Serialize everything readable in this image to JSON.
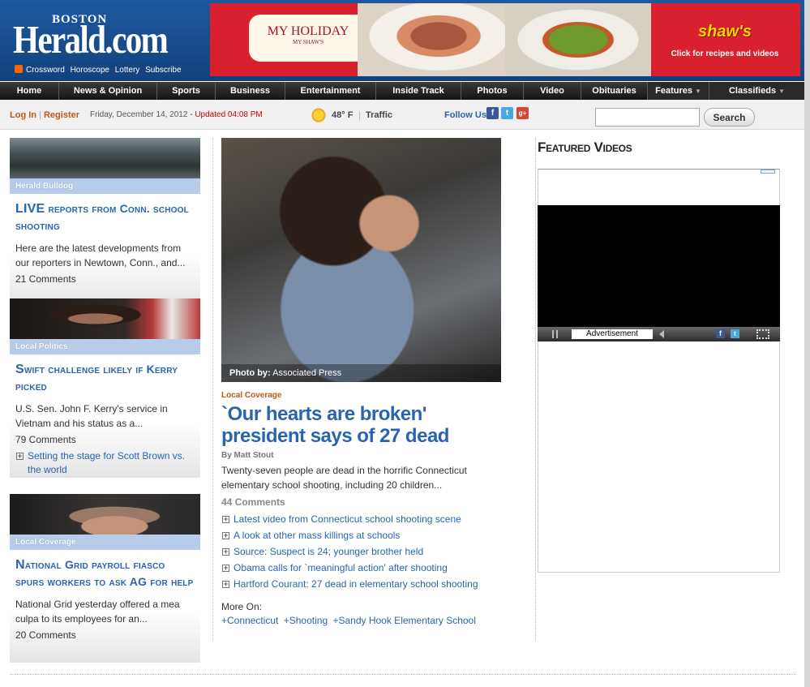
{
  "header": {
    "logo_top": "BOSTON",
    "logo_main": "Herald.com",
    "links": [
      "Crossword",
      "Horoscope",
      "Lottery",
      "Subscribe"
    ],
    "ad": {
      "badge_line1": "MY HOLIDAY",
      "badge_line2": "MY SHAW'S",
      "brand": "shaw's",
      "cta": "Click for recipes and videos",
      "color": "#d9202f"
    }
  },
  "nav": {
    "items": [
      {
        "label": "Home"
      },
      {
        "label": "News & Opinion"
      },
      {
        "label": "Sports"
      },
      {
        "label": "Business"
      },
      {
        "label": "Entertainment"
      },
      {
        "label": "Inside Track"
      },
      {
        "label": "Photos"
      },
      {
        "label": "Video"
      },
      {
        "label": "Obituaries"
      },
      {
        "label": "Features"
      },
      {
        "label": "Classifieds"
      }
    ]
  },
  "util": {
    "login": "Log In",
    "register": "Register",
    "date": "Friday, December 14, 2012",
    "updated": "- Updated 04:08 PM",
    "temp": "48° F",
    "traffic": "Traffic",
    "follow": "Follow Us",
    "search_value": "",
    "search_button": "Search"
  },
  "left_cards": [
    {
      "section": "Herald Bulldog",
      "headline_big": "LIVE",
      "headline_rest": " reports from Conn. school shooting",
      "desc": "Here are the latest developments from our reporters in Newtown, Conn., and...",
      "comments": "21 Comments"
    },
    {
      "section": "Local Politics",
      "headline_big": "S",
      "headline_rest": "wift challenge likely if Kerry picked",
      "desc": "U.S. Sen. John F. Kerry's service in Vietnam and his status as a...",
      "comments": "79 Comments",
      "related": "Setting the stage for Scott Brown vs. the world"
    },
    {
      "section": "Local Coverage",
      "headline_big": "N",
      "headline_rest": "ational Grid payroll fiasco spurs workers to ask AG for help",
      "desc": "National Grid yesterday offered a mea culpa to its employees for an...",
      "comments": "20 Comments"
    }
  ],
  "main_story": {
    "photo_credit_label": "Photo by:",
    "photo_credit": "Associated Press",
    "section": "Local Coverage",
    "headline": "`Our hearts are broken' president says of 27 dead",
    "byline": "By Matt Stout",
    "desc": "Twenty-seven people are dead in the horrific Connecticut elementary school shooting, including 20 children...",
    "comments": "44 Comments",
    "related": [
      "Latest video from Connecticut school shooting scene",
      "A look at other mass killings at schools",
      "Source: Suspect is 24; younger brother held",
      "Obama calls for `meaningful action' after shooting",
      "Hartford Courant: 27 dead in elementary school shooting"
    ],
    "more_on": "More On:",
    "tags": [
      "+Connecticut",
      "+Shooting",
      "+Sandy Hook Elementary School"
    ]
  },
  "featured": {
    "title": "Featured Videos",
    "ad_label": "Advertisement"
  }
}
